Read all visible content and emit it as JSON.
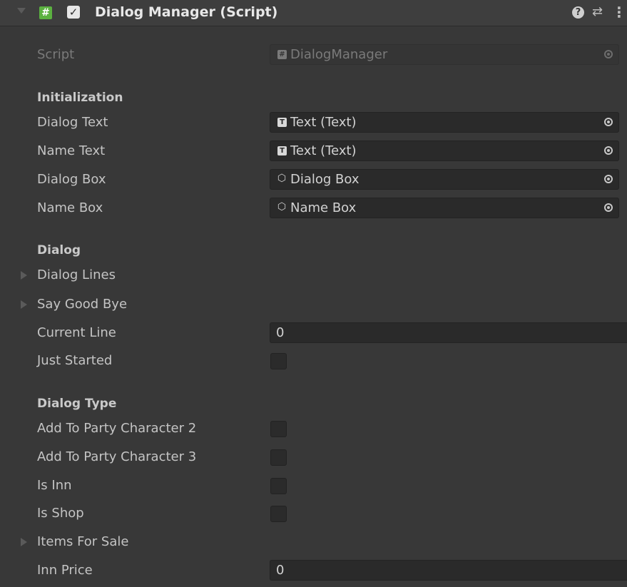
{
  "component": {
    "title": "Dialog Manager (Script)",
    "enabled_check": "✓",
    "script_icon_glyph": "#",
    "help_icon_glyph": "?",
    "presets_icon_glyph": "⇄",
    "menu_icon_glyph": "⋮"
  },
  "script_field": {
    "label": "Script",
    "value": "DialogManager"
  },
  "sections": {
    "initialization": "Initialization",
    "dialog": "Dialog",
    "dialog_type": "Dialog Type"
  },
  "initialization_fields": [
    {
      "label": "Dialog Text",
      "value": "Text (Text)",
      "icon": "text-icon"
    },
    {
      "label": "Name Text",
      "value": "Text (Text)",
      "icon": "text-icon"
    },
    {
      "label": "Dialog Box",
      "value": "Dialog Box",
      "icon": "gameobject-icon"
    },
    {
      "label": "Name Box",
      "value": "Name Box",
      "icon": "gameobject-icon"
    }
  ],
  "dialog_fields": {
    "dialog_lines": "Dialog Lines",
    "say_good_bye": "Say Good Bye",
    "current_line_label": "Current Line",
    "current_line_value": "0",
    "just_started_label": "Just Started",
    "just_started_checked": false
  },
  "dialog_type_fields": {
    "add_party_2": "Add To Party Character 2",
    "add_party_3": "Add To Party Character 3",
    "is_inn": "Is Inn",
    "is_shop": "Is Shop",
    "items_for_sale": "Items For Sale",
    "inn_price_label": "Inn Price",
    "inn_price_value": "0"
  },
  "icons": {
    "text_glyph": "T",
    "cube_glyph": "⬡",
    "script_glyph": "#"
  },
  "colors": {
    "background": "#383838",
    "header": "#3e3e3e",
    "field": "#2a2a2a",
    "script_icon": "#5bb140"
  }
}
